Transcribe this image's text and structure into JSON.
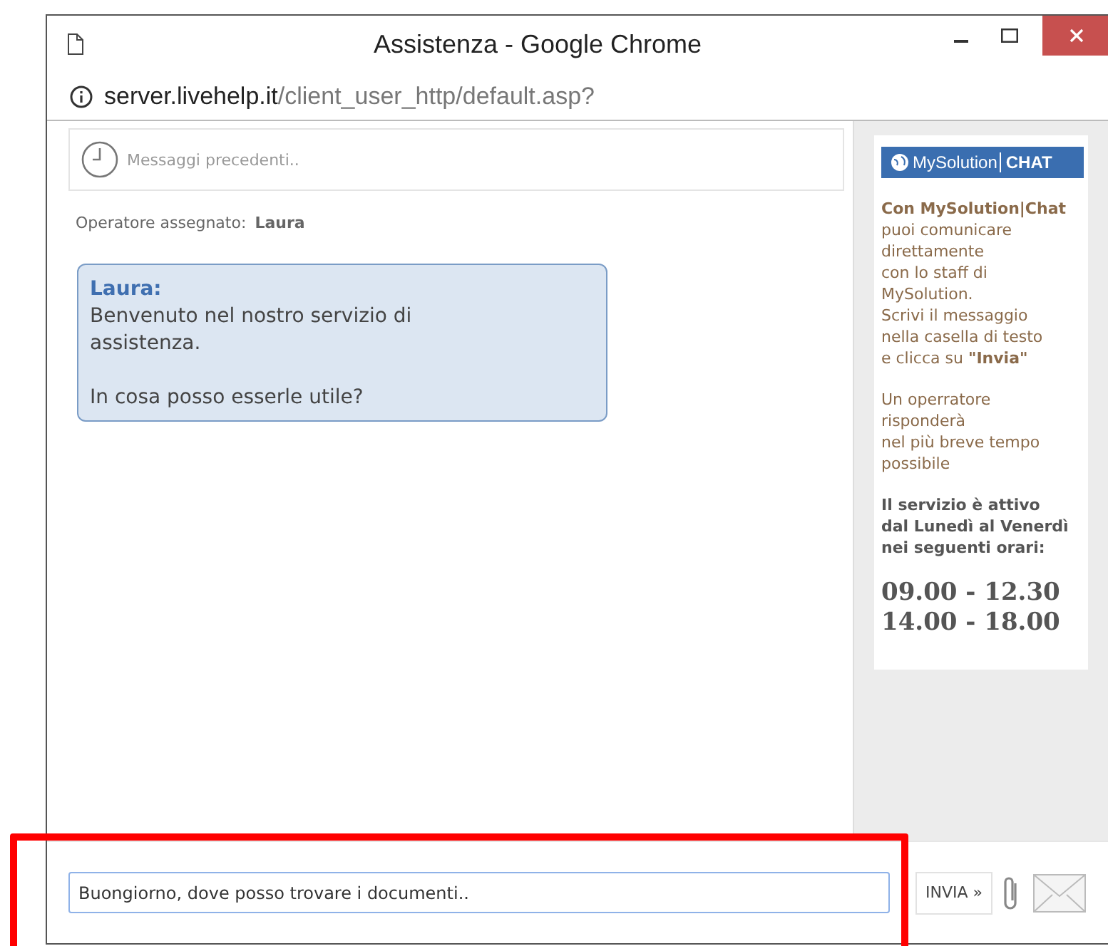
{
  "window": {
    "title": "Assistenza - Google Chrome"
  },
  "address_bar": {
    "host": "server.livehelp.it",
    "path": "/client_user_http/default.asp?"
  },
  "history_link": "Messaggi precedenti..",
  "operator": {
    "label": "Operatore assegnato:",
    "name": "Laura"
  },
  "messages": [
    {
      "author": "Laura:",
      "paragraphs": [
        "Benvenuto nel nostro servizio di assistenza.",
        "In cosa posso esserle utile?"
      ]
    }
  ],
  "sidebar": {
    "logo": {
      "brand": "MySolution",
      "product": "CHAT"
    },
    "paragraphs": [
      {
        "kind": "text",
        "lines": [
          "**Con MySolution|Chat**",
          "puoi comunicare",
          "direttamente",
          "con lo staff di",
          "MySolution.",
          "Scrivi il messaggio",
          "nella casella di testo",
          "e clicca su **\"Invia\"**"
        ]
      },
      {
        "kind": "text",
        "lines": [
          "Un operratore",
          "risponderà",
          "nel più breve tempo",
          "possibile"
        ]
      },
      {
        "kind": "bold",
        "lines": [
          "Il servizio è attivo",
          "dal Lunedì al Venerdì",
          "nei seguenti orari:"
        ]
      },
      {
        "kind": "hours",
        "lines": [
          "09.00 - 12.30",
          "14.00 - 18.00"
        ]
      }
    ]
  },
  "composer": {
    "value": "Buongiorno, dove posso trovare i documenti..",
    "send_button": "INVIA »"
  },
  "annotation": {
    "kind": "highlight-frame"
  }
}
